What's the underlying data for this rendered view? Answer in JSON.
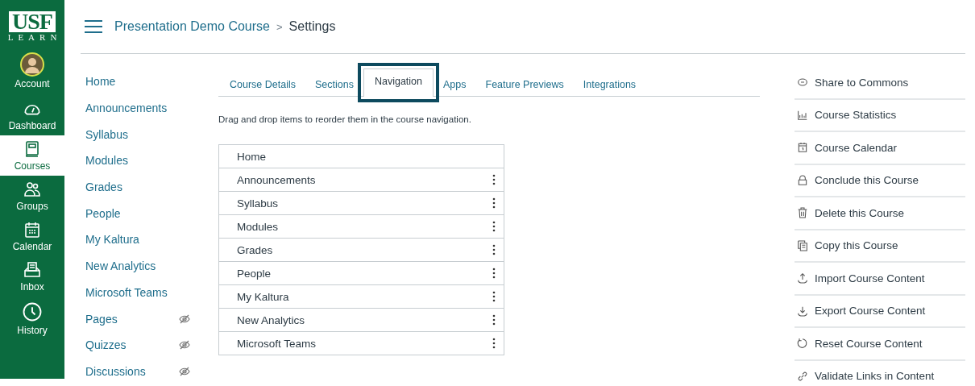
{
  "logo": {
    "title": "USF",
    "subtitle": "LEARN"
  },
  "global_nav": [
    {
      "label": "Account",
      "selected": false
    },
    {
      "label": "Dashboard",
      "selected": false
    },
    {
      "label": "Courses",
      "selected": true
    },
    {
      "label": "Groups",
      "selected": false
    },
    {
      "label": "Calendar",
      "selected": false
    },
    {
      "label": "Inbox",
      "selected": false
    },
    {
      "label": "History",
      "selected": false
    }
  ],
  "breadcrumb": {
    "course": "Presentation Demo Course",
    "separator": ">",
    "page": "Settings"
  },
  "course_nav": [
    {
      "label": "Home",
      "hidden": false
    },
    {
      "label": "Announcements",
      "hidden": false
    },
    {
      "label": "Syllabus",
      "hidden": false
    },
    {
      "label": "Modules",
      "hidden": false
    },
    {
      "label": "Grades",
      "hidden": false
    },
    {
      "label": "People",
      "hidden": false
    },
    {
      "label": "My Kaltura",
      "hidden": false
    },
    {
      "label": "New Analytics",
      "hidden": false
    },
    {
      "label": "Microsoft Teams",
      "hidden": false
    },
    {
      "label": "Pages",
      "hidden": true
    },
    {
      "label": "Quizzes",
      "hidden": true
    },
    {
      "label": "Discussions",
      "hidden": true
    }
  ],
  "tabs": [
    {
      "label": "Course Details",
      "selected": false
    },
    {
      "label": "Sections",
      "selected": false
    },
    {
      "label": "Navigation",
      "selected": true
    },
    {
      "label": "Apps",
      "selected": false
    },
    {
      "label": "Feature Previews",
      "selected": false
    },
    {
      "label": "Integrations",
      "selected": false
    }
  ],
  "instructions": "Drag and drop items to reorder them in the course navigation.",
  "navigation_items": [
    {
      "label": "Home",
      "has_menu": false
    },
    {
      "label": "Announcements",
      "has_menu": true
    },
    {
      "label": "Syllabus",
      "has_menu": true
    },
    {
      "label": "Modules",
      "has_menu": true
    },
    {
      "label": "Grades",
      "has_menu": true
    },
    {
      "label": "People",
      "has_menu": true
    },
    {
      "label": "My Kaltura",
      "has_menu": true
    },
    {
      "label": "New Analytics",
      "has_menu": true
    },
    {
      "label": "Microsoft Teams",
      "has_menu": true
    }
  ],
  "actions": [
    "Share to Commons",
    "Course Statistics",
    "Course Calendar",
    "Conclude this Course",
    "Delete this Course",
    "Copy this Course",
    "Import Course Content",
    "Export Course Content",
    "Reset Course Content",
    "Validate Links in Content"
  ]
}
